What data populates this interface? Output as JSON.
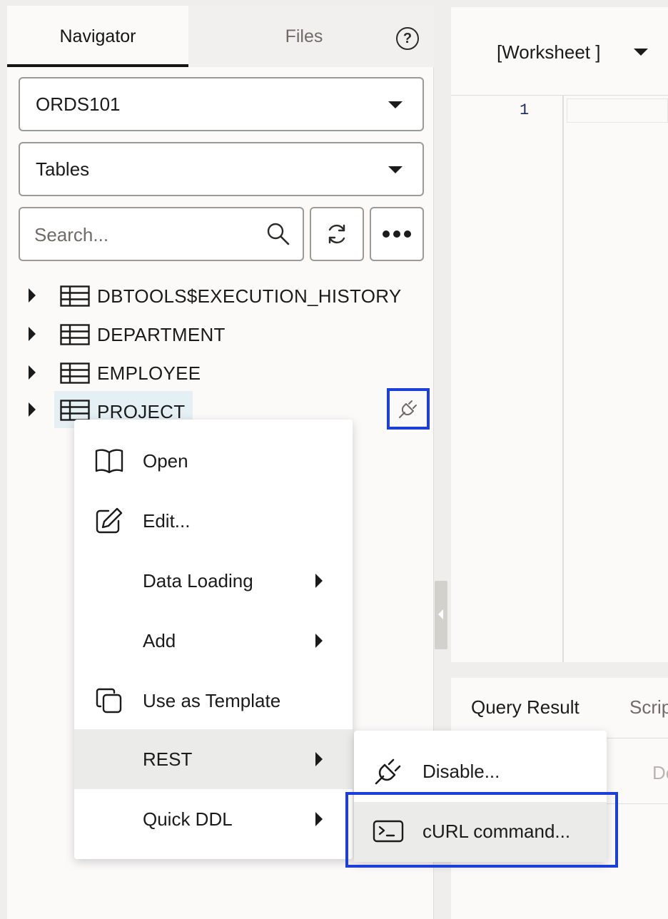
{
  "navigator": {
    "tabs": [
      {
        "label": "Navigator",
        "active": true
      },
      {
        "label": "Files",
        "active": false
      }
    ],
    "help_label": "?",
    "schema_select": "ORDS101",
    "object_type_select": "Tables",
    "search": {
      "value": "",
      "placeholder": "Search..."
    },
    "tree": [
      {
        "label": "DBTOOLS$EXECUTION_HISTORY",
        "icon": "table-icon"
      },
      {
        "label": "DEPARTMENT",
        "icon": "table-icon"
      },
      {
        "label": "EMPLOYEE",
        "icon": "table-icon"
      },
      {
        "label": "PROJECT",
        "icon": "table-icon",
        "selected": true,
        "rest_enabled_icon": "plug-icon"
      }
    ]
  },
  "editor": {
    "worksheet_title": "[Worksheet ]",
    "line_numbers": [
      "1"
    ]
  },
  "results": {
    "tabs": [
      "Query Result",
      "Scrip"
    ],
    "toolbar_partial": "De"
  },
  "context_menu": {
    "items": [
      {
        "label": "Open",
        "icon": "book-open-icon",
        "has_submenu": false
      },
      {
        "label": "Edit...",
        "icon": "pencil-icon",
        "has_submenu": false
      },
      {
        "label": "Data Loading",
        "icon": "",
        "has_submenu": true
      },
      {
        "label": "Add",
        "icon": "",
        "has_submenu": true
      },
      {
        "label": "Use as Template",
        "icon": "copy-icon",
        "has_submenu": false
      },
      {
        "label": "REST",
        "icon": "",
        "has_submenu": true,
        "hovered": true
      },
      {
        "label": "Quick DDL",
        "icon": "",
        "has_submenu": true
      }
    ]
  },
  "rest_submenu": {
    "items": [
      {
        "label": "Disable...",
        "icon": "plug-icon"
      },
      {
        "label": "cURL command...",
        "icon": "terminal-icon",
        "hovered": true,
        "highlighted": true
      }
    ]
  },
  "colors": {
    "highlight_border": "#1d3fd9",
    "selected_row": "#e5f0f4",
    "menu_hover": "#ebebea"
  }
}
